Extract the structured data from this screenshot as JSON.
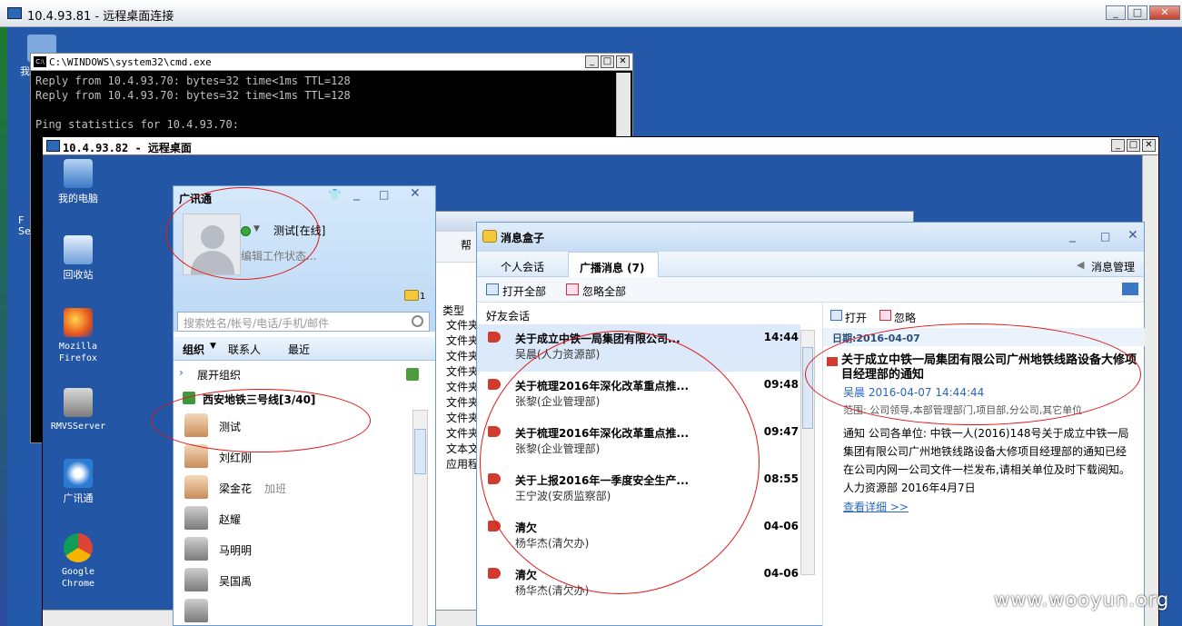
{
  "outer": {
    "title": "10.4.93.81 - 远程桌面连接"
  },
  "outer_desktop": {
    "icon_labels": [
      "我",
      "F",
      "Se"
    ]
  },
  "cmd": {
    "title": "C:\\WINDOWS\\system32\\cmd.exe",
    "lines": [
      "Reply from 10.4.93.70: bytes=32 time<1ms TTL=128",
      "Reply from 10.4.93.70: bytes=32 time<1ms TTL=128",
      "",
      "Ping statistics for 10.4.93.70:"
    ]
  },
  "inner": {
    "title": "10.4.93.82 - 远程桌面",
    "desktop_icons": [
      {
        "label": "我的电脑",
        "icon": "computer-icon"
      },
      {
        "label": "回收站",
        "icon": "recycle-bin-icon"
      },
      {
        "label": "Mozilla Firefox",
        "icon": "firefox-icon"
      },
      {
        "label": "RMVSServer",
        "icon": "server-icon"
      },
      {
        "label": "广讯通",
        "icon": "chat-app-icon"
      },
      {
        "label": "Google Chrome",
        "icon": "chrome-icon"
      }
    ]
  },
  "explorer": {
    "menu_partial": "帮",
    "col_header": "类型",
    "rows": [
      "文件夹",
      "文件夹",
      "文件夹",
      "文件夹",
      "文件夹",
      "文件夹",
      "文件夹",
      "文件夹",
      "文本文",
      "应用程"
    ]
  },
  "gxt": {
    "title": "广讯通",
    "user_name": "测试[在线]",
    "edit_status": "编辑工作状态...",
    "msg_count": "1",
    "search_placeholder": "搜索姓名/帐号/电话/手机/邮件",
    "tabs": [
      "组织",
      "联系人",
      "最近"
    ],
    "expand_org": "展开组织",
    "group": "西安地铁三号线[3/40]",
    "contacts": [
      {
        "name": "测试",
        "status": ""
      },
      {
        "name": "刘红刚",
        "status": ""
      },
      {
        "name": "梁金花",
        "status": "加班"
      },
      {
        "name": "赵耀",
        "status": ""
      },
      {
        "name": "马明明",
        "status": ""
      },
      {
        "name": "吴国禹",
        "status": ""
      }
    ]
  },
  "msgbox": {
    "title": "消息盒子",
    "tabs": {
      "personal": "个人会话",
      "broadcast": "广播消息 (7)"
    },
    "manager": "消息管理器",
    "toolbar": {
      "open_all": "打开全部",
      "ignore_all": "忽略全部"
    },
    "friends_label": "好友会话",
    "messages": [
      {
        "title": "关于成立中铁一局集团有限公司...",
        "from": "吴晨(人力资源部)",
        "time": "14:44"
      },
      {
        "title": "关于梳理2016年深化改革重点推...",
        "from": "张黎(企业管理部)",
        "time": "09:48"
      },
      {
        "title": "关于梳理2016年深化改革重点推...",
        "from": "张黎(企业管理部)",
        "time": "09:47"
      },
      {
        "title": "关于上报2016年一季度安全生产...",
        "from": "王宁波(安质监察部)",
        "time": "08:55"
      },
      {
        "title": "清欠",
        "from": "杨华杰(清欠办)",
        "time": "04-06"
      },
      {
        "title": "清欠",
        "from": "杨华杰(清欠办)",
        "time": "04-06"
      }
    ],
    "detail": {
      "open": "打开",
      "ignore": "忽略",
      "date": "日期:2016-04-07",
      "title": "关于成立中铁一局集团有限公司广州地铁线路设备大修项目经理部的通知",
      "author": "吴晨  2016-04-07 14:44:44",
      "scope": "范围:  公司领导,本部管理部门,项目部,分公司,其它单位",
      "body": "通知 公司各单位: 中铁一人(2016)148号关于成立中铁一局集团有限公司广州地铁线路设备大修项目经理部的通知已经在公司内网一公司文件一栏发布,请相关单位及时下载阅知。 人力资源部 2016年4月7日",
      "link": "查看详细 >>"
    }
  },
  "watermark": "www.wooyun.org"
}
